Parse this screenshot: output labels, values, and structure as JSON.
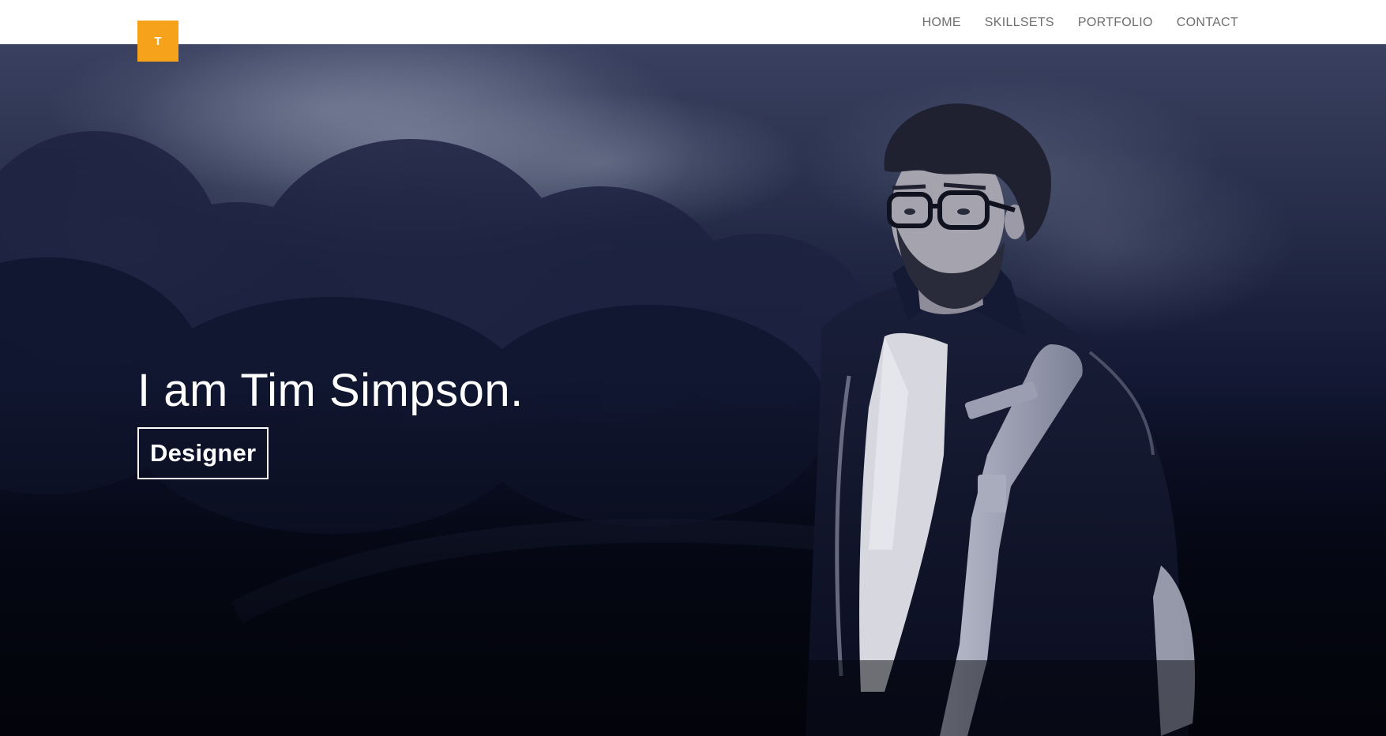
{
  "logo": {
    "text": "T",
    "color": "#f7a21b"
  },
  "nav": {
    "items": [
      {
        "label": "HOME"
      },
      {
        "label": "SKILLSETS"
      },
      {
        "label": "PORTFOLIO"
      },
      {
        "label": "CONTACT"
      }
    ]
  },
  "hero": {
    "title": "I am Tim Simpson.",
    "role": "Designer"
  },
  "colors": {
    "accent": "#f7a21b",
    "hero_dark": "#05070f",
    "nav_text": "#6d6d6d"
  }
}
